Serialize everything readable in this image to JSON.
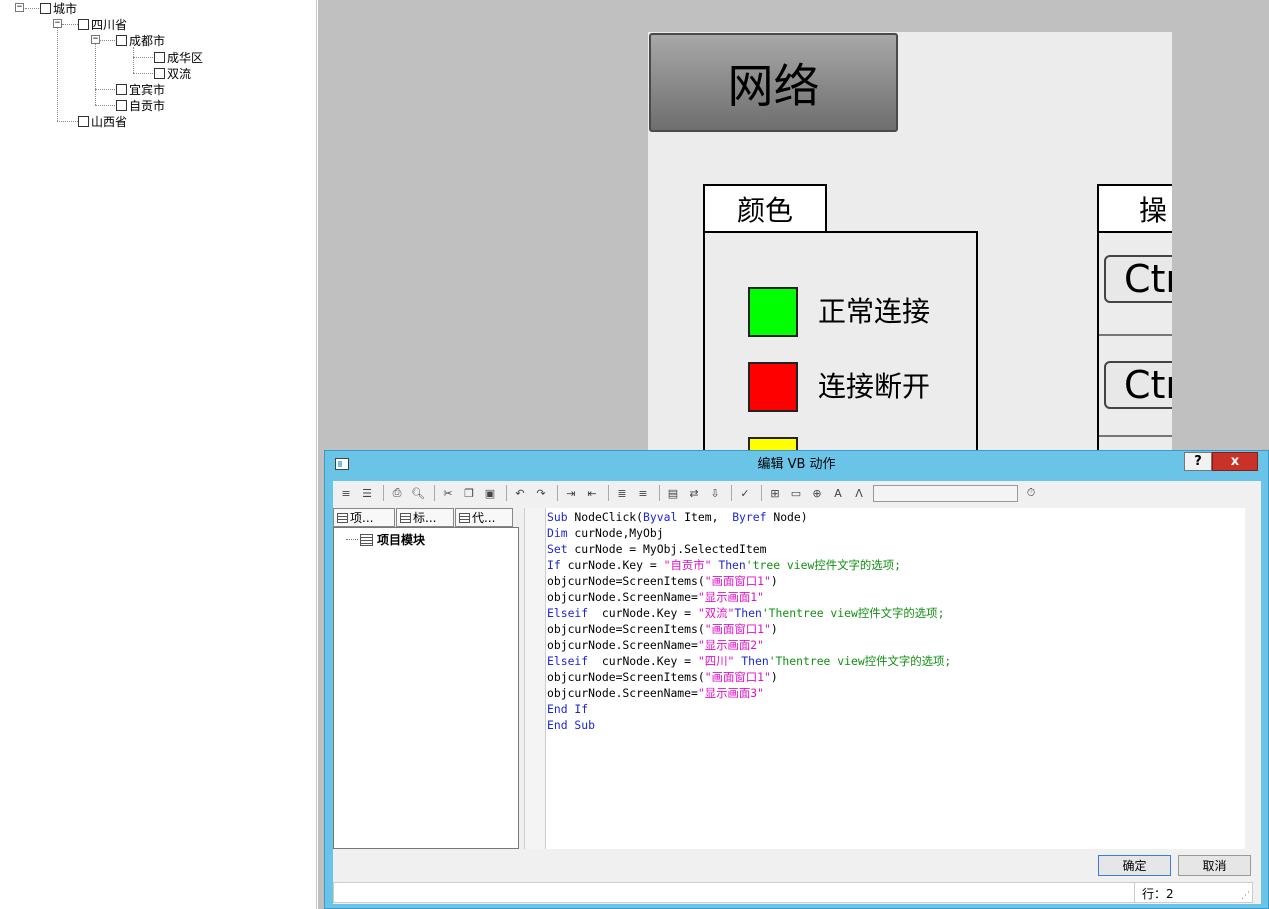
{
  "tree": {
    "root": "城市",
    "sichuan": "四川省",
    "chengdu": "成都市",
    "chenghua": "成华区",
    "shuangliu": "双流",
    "yibin": "宜宾市",
    "zigong": "自贡市",
    "shanxi": "山西省"
  },
  "picture": {
    "network_button": "网络",
    "color_tab": "颜色",
    "legend": [
      {
        "color": "#00ff00",
        "label": "正常连接"
      },
      {
        "color": "#ff0000",
        "label": "连接断开"
      },
      {
        "color": "#ffff00",
        "label": ""
      }
    ],
    "op_tab": "操",
    "ctrl_buttons": [
      "Ctr",
      "Ctr"
    ]
  },
  "dialog": {
    "title": "编辑 VB 动作",
    "help": "?",
    "close": "x",
    "tabs": [
      "项...",
      "标...",
      "代..."
    ],
    "tree_item": "项目模块",
    "ok": "确定",
    "cancel": "取消",
    "status_line": "行：2"
  },
  "code": [
    [
      [
        "kw",
        "Sub"
      ],
      [
        "nm",
        " NodeClick("
      ],
      [
        "kw",
        "Byval"
      ],
      [
        "nm",
        " Item,  "
      ],
      [
        "kw",
        "Byref"
      ],
      [
        "nm",
        " Node)"
      ]
    ],
    [
      [
        "kw",
        "Dim"
      ],
      [
        "nm",
        " curNode,MyObj"
      ]
    ],
    [
      [
        "kw",
        "Set"
      ],
      [
        "nm",
        " curNode = MyObj.SelectedItem"
      ]
    ],
    [
      [
        "kw",
        "If"
      ],
      [
        "nm",
        " curNode.Key = "
      ],
      [
        "st",
        "\"自贡市\""
      ],
      [
        "nm",
        " "
      ],
      [
        "kw",
        "Then"
      ],
      [
        "cm",
        "'tree view控件文字的选项;"
      ]
    ],
    [
      [
        "nm",
        "objcurNode=ScreenItems("
      ],
      [
        "st",
        "\"画面窗口1\""
      ],
      [
        "nm",
        ")"
      ]
    ],
    [
      [
        "nm",
        "objcurNode.ScreenName="
      ],
      [
        "st",
        "\"显示画面1\""
      ]
    ],
    [
      [
        "kw",
        "Elseif"
      ],
      [
        "nm",
        "  curNode.Key = "
      ],
      [
        "st",
        "\"双流\""
      ],
      [
        "kw",
        "Then"
      ],
      [
        "cm",
        "'Thentree view控件文字的选项;"
      ]
    ],
    [
      [
        "nm",
        "objcurNode=ScreenItems("
      ],
      [
        "st",
        "\"画面窗口1\""
      ],
      [
        "nm",
        ")"
      ]
    ],
    [
      [
        "nm",
        "objcurNode.ScreenName="
      ],
      [
        "st",
        "\"显示画面2\""
      ]
    ],
    [
      [
        "kw",
        "Elseif"
      ],
      [
        "nm",
        "  curNode.Key = "
      ],
      [
        "st",
        "\"四川\""
      ],
      [
        "nm",
        " "
      ],
      [
        "kw",
        "Then"
      ],
      [
        "cm",
        "'Thentree view控件文字的选项;"
      ]
    ],
    [
      [
        "nm",
        "objcurNode=ScreenItems("
      ],
      [
        "st",
        "\"画面窗口1\""
      ],
      [
        "nm",
        ")"
      ]
    ],
    [
      [
        "nm",
        "objcurNode.ScreenName="
      ],
      [
        "st",
        "\"显示画面3\""
      ]
    ],
    [
      [
        "kw",
        "End If"
      ]
    ],
    [
      [
        "kw",
        "End Sub"
      ]
    ]
  ]
}
